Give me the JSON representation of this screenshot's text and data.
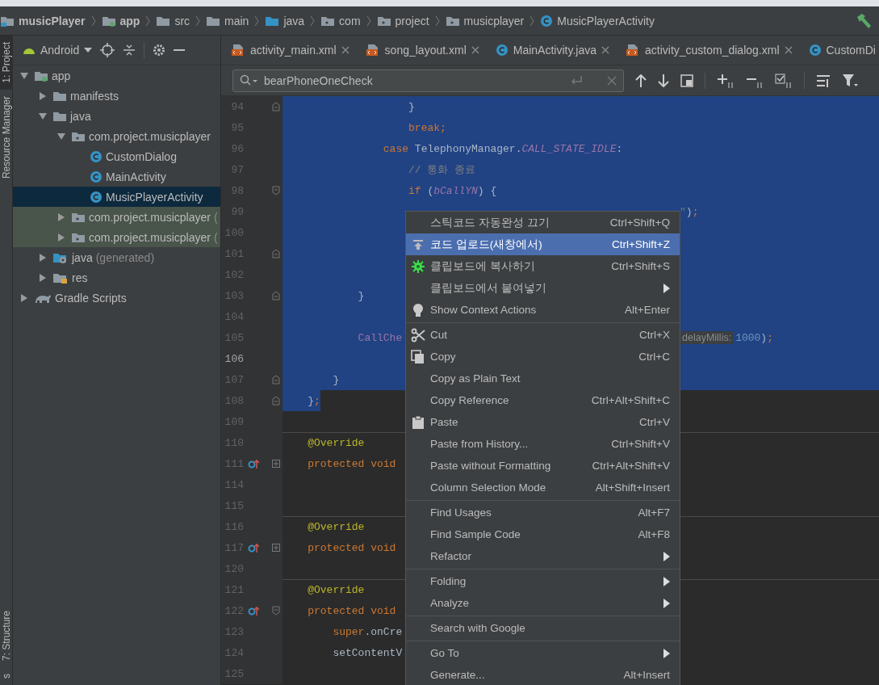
{
  "breadcrumbs": [
    {
      "label": "musicPlayer",
      "kind": "project",
      "bold": true
    },
    {
      "label": "app",
      "kind": "module",
      "bold": true
    },
    {
      "label": "src",
      "kind": "folder",
      "bold": false
    },
    {
      "label": "main",
      "kind": "folder",
      "bold": false
    },
    {
      "label": "java",
      "kind": "source",
      "bold": false
    },
    {
      "label": "com",
      "kind": "package",
      "bold": false
    },
    {
      "label": "project",
      "kind": "package",
      "bold": false
    },
    {
      "label": "musicplayer",
      "kind": "package",
      "bold": false
    },
    {
      "label": "MusicPlayerActivity",
      "kind": "class",
      "bold": false
    }
  ],
  "tool_strip": {
    "top": [
      {
        "label": "1: Project",
        "selected": true
      },
      {
        "label": "Resource Manager",
        "selected": false
      }
    ],
    "bottom": [
      {
        "label": "7: Structure",
        "selected": false
      },
      {
        "label": "s",
        "selected": false
      }
    ]
  },
  "project_view": {
    "mode": "Android"
  },
  "tree": [
    {
      "label": "app",
      "kind": "module",
      "expanded": true,
      "selected": false,
      "highlighted": false,
      "children": [
        {
          "label": "manifests",
          "kind": "folder",
          "expanded": false,
          "selected": false,
          "highlighted": false
        },
        {
          "label": "java",
          "kind": "folder",
          "expanded": true,
          "selected": false,
          "highlighted": false,
          "children": [
            {
              "label": "com.project.musicplayer",
              "kind": "package",
              "expanded": true,
              "selected": false,
              "highlighted": false,
              "children": [
                {
                  "label": "CustomDialog",
                  "kind": "class",
                  "selected": false,
                  "highlighted": false
                },
                {
                  "label": "MainActivity",
                  "kind": "class",
                  "selected": false,
                  "highlighted": false
                },
                {
                  "label": "MusicPlayerActivity",
                  "kind": "class",
                  "selected": true,
                  "highlighted": false
                }
              ]
            },
            {
              "label": "com.project.musicplayer",
              "suffix": "(",
              "kind": "package",
              "expanded": false,
              "selected": false,
              "highlighted": true
            },
            {
              "label": "com.project.musicplayer",
              "suffix": "(",
              "kind": "package",
              "expanded": false,
              "selected": false,
              "highlighted": true
            }
          ]
        },
        {
          "label": "java",
          "suffix": "(generated)",
          "kind": "generated",
          "expanded": false,
          "selected": false,
          "highlighted": false
        },
        {
          "label": "res",
          "kind": "res",
          "expanded": false,
          "selected": false,
          "highlighted": false
        }
      ]
    },
    {
      "label": "Gradle Scripts",
      "kind": "gradle",
      "expanded": false,
      "selected": false,
      "highlighted": false
    }
  ],
  "tabs": [
    {
      "label": "activity_main.xml",
      "kind": "xml",
      "selected": false,
      "closable": true
    },
    {
      "label": "song_layout.xml",
      "kind": "xml",
      "selected": false,
      "closable": true
    },
    {
      "label": "MainActivity.java",
      "kind": "class",
      "selected": false,
      "closable": true
    },
    {
      "label": "activity_custom_dialog.xml",
      "kind": "xml",
      "selected": false,
      "closable": true
    },
    {
      "label": "CustomDi",
      "kind": "class",
      "selected": false,
      "closable": false
    }
  ],
  "find": {
    "value": "bearPhoneOneCheck"
  },
  "code_lines": [
    {
      "number": "94",
      "selected": true,
      "current": false,
      "divider": false,
      "fold_end": true,
      "left": [
        {
          "text": "                    }",
          "kind": "plain"
        }
      ]
    },
    {
      "number": "95",
      "selected": true,
      "current": false,
      "divider": false,
      "left": [
        {
          "text": "                    break;",
          "kind": "keyword"
        }
      ]
    },
    {
      "number": "96",
      "selected": true,
      "current": false,
      "divider": false,
      "left": [
        {
          "text": "                case",
          "kind": "keyword"
        },
        {
          "text": " TelephonyManager.",
          "kind": "plain"
        },
        {
          "text": "CALL_STATE_IDLE",
          "kind": "constant"
        },
        {
          "text": ":",
          "kind": "plain"
        }
      ]
    },
    {
      "number": "97",
      "selected": true,
      "current": false,
      "divider": false,
      "left": [
        {
          "text": "                    // 통화 종료",
          "kind": "comment"
        }
      ]
    },
    {
      "number": "98",
      "selected": true,
      "current": false,
      "divider": false,
      "fold_start": true,
      "left": [
        {
          "text": "                    if",
          "kind": "keyword"
        },
        {
          "text": " (",
          "kind": "plain"
        },
        {
          "text": "bCallYN",
          "kind": "constant"
        },
        {
          "text": ") {",
          "kind": "plain"
        }
      ]
    },
    {
      "number": "99",
      "selected": true,
      "current": false,
      "divider": false,
      "right": [
        {
          "text": "\"",
          "kind": "string"
        },
        {
          "text": ")",
          "kind": "plain"
        },
        {
          "text": ";",
          "kind": "keyword"
        }
      ]
    },
    {
      "number": "100",
      "selected": true,
      "current": false,
      "divider": false
    },
    {
      "number": "101",
      "selected": true,
      "current": false,
      "divider": false,
      "fold_end": true
    },
    {
      "number": "102",
      "selected": true,
      "current": false,
      "divider": false
    },
    {
      "number": "103",
      "selected": true,
      "current": false,
      "divider": false,
      "fold_end": true,
      "left": [
        {
          "text": "            }",
          "kind": "plain"
        }
      ]
    },
    {
      "number": "104",
      "selected": true,
      "current": false,
      "divider": false
    },
    {
      "number": "105",
      "selected": true,
      "current": false,
      "divider": false,
      "left": [
        {
          "text": "            CallChe",
          "kind": "member"
        }
      ],
      "right": [
        {
          "text": "delayMillis:",
          "kind": "hint"
        },
        {
          "text": "1000",
          "kind": "number"
        },
        {
          "text": ")",
          "kind": "plain"
        },
        {
          "text": ";",
          "kind": "keyword"
        }
      ]
    },
    {
      "number": "106",
      "selected": true,
      "current": true,
      "divider": false
    },
    {
      "number": "107",
      "selected": true,
      "current": false,
      "divider": false,
      "fold_end": true,
      "left": [
        {
          "text": "        }",
          "kind": "plain"
        }
      ]
    },
    {
      "number": "108",
      "selected": false,
      "text_selected": true,
      "current": false,
      "divider": false,
      "fold_end": true,
      "left": [
        {
          "text": "    }",
          "kind": "plain"
        },
        {
          "text": ";",
          "kind": "keyword"
        }
      ]
    },
    {
      "number": "109",
      "selected": false,
      "current": false,
      "divider": false
    },
    {
      "number": "110",
      "selected": false,
      "current": false,
      "divider": true,
      "left": [
        {
          "text": "    @Override",
          "kind": "annotation"
        }
      ]
    },
    {
      "number": "111",
      "selected": false,
      "current": false,
      "divider": false,
      "overrides": true,
      "folded": true,
      "left": [
        {
          "text": "    protected void",
          "kind": "keyword"
        }
      ]
    },
    {
      "number": "114",
      "selected": false,
      "current": false,
      "divider": false
    },
    {
      "number": "115",
      "selected": false,
      "current": false,
      "divider": false
    },
    {
      "number": "116",
      "selected": false,
      "current": false,
      "divider": true,
      "left": [
        {
          "text": "    @Override",
          "kind": "annotation"
        }
      ]
    },
    {
      "number": "117",
      "selected": false,
      "current": false,
      "divider": false,
      "overrides": true,
      "folded": true,
      "left": [
        {
          "text": "    protected void",
          "kind": "keyword"
        }
      ]
    },
    {
      "number": "120",
      "selected": false,
      "current": false,
      "divider": false
    },
    {
      "number": "121",
      "selected": false,
      "current": false,
      "divider": true,
      "left": [
        {
          "text": "    @Override",
          "kind": "annotation"
        }
      ]
    },
    {
      "number": "122",
      "selected": false,
      "current": false,
      "divider": false,
      "overrides": true,
      "fold_start": true,
      "left": [
        {
          "text": "    protected void",
          "kind": "keyword"
        }
      ]
    },
    {
      "number": "123",
      "selected": false,
      "current": false,
      "divider": false,
      "left": [
        {
          "text": "        super",
          "kind": "keyword"
        },
        {
          "text": ".onCre",
          "kind": "plain"
        }
      ]
    },
    {
      "number": "124",
      "selected": false,
      "current": false,
      "divider": false,
      "left": [
        {
          "text": "        setContentV",
          "kind": "plain"
        }
      ]
    },
    {
      "number": "125",
      "selected": false,
      "current": false,
      "divider": false
    }
  ],
  "context_menu": [
    {
      "kind": "plain",
      "label": "스틱코드 자동완성 끄기",
      "shortcut": "Ctrl+Shift+Q",
      "submenu": false,
      "selected": false
    },
    {
      "kind": "upload",
      "label": "코드 업로드(새창에서)",
      "shortcut": "Ctrl+Shift+Z",
      "submenu": false,
      "selected": true
    },
    {
      "kind": "bug",
      "label": "클립보드에 복사하기",
      "shortcut": "Ctrl+Shift+S",
      "submenu": false,
      "selected": false
    },
    {
      "kind": "plain",
      "label": "클립보드에서 붙여넣기",
      "submenu": true,
      "selected": false
    },
    {
      "kind": "bulb",
      "label": "Show Context Actions",
      "shortcut": "Alt+Enter",
      "submenu": false,
      "selected": false
    },
    {
      "kind": "separator"
    },
    {
      "kind": "cut",
      "label": "Cut",
      "shortcut": "Ctrl+X",
      "submenu": false,
      "selected": false
    },
    {
      "kind": "copy",
      "label": "Copy",
      "shortcut": "Ctrl+C",
      "submenu": false,
      "selected": false
    },
    {
      "kind": "plain",
      "label": "Copy as Plain Text",
      "submenu": false,
      "selected": false
    },
    {
      "kind": "plain",
      "label": "Copy Reference",
      "shortcut": "Ctrl+Alt+Shift+C",
      "submenu": false,
      "selected": false
    },
    {
      "kind": "paste",
      "label": "Paste",
      "shortcut": "Ctrl+V",
      "submenu": false,
      "selected": false
    },
    {
      "kind": "plain",
      "label": "Paste from History...",
      "shortcut": "Ctrl+Shift+V",
      "submenu": false,
      "selected": false
    },
    {
      "kind": "plain",
      "label": "Paste without Formatting",
      "shortcut": "Ctrl+Alt+Shift+V",
      "submenu": false,
      "selected": false
    },
    {
      "kind": "plain",
      "label": "Column Selection Mode",
      "shortcut": "Alt+Shift+Insert",
      "submenu": false,
      "selected": false
    },
    {
      "kind": "separator"
    },
    {
      "kind": "plain",
      "label": "Find Usages",
      "shortcut": "Alt+F7",
      "submenu": false,
      "selected": false
    },
    {
      "kind": "plain",
      "label": "Find Sample Code",
      "shortcut": "Alt+F8",
      "submenu": false,
      "selected": false
    },
    {
      "kind": "plain",
      "label": "Refactor",
      "submenu": true,
      "selected": false
    },
    {
      "kind": "separator"
    },
    {
      "kind": "plain",
      "label": "Folding",
      "submenu": true,
      "selected": false
    },
    {
      "kind": "plain",
      "label": "Analyze",
      "submenu": true,
      "selected": false
    },
    {
      "kind": "separator"
    },
    {
      "kind": "plain",
      "label": "Search with Google",
      "submenu": false,
      "selected": false
    },
    {
      "kind": "separator"
    },
    {
      "kind": "plain",
      "label": "Go To",
      "submenu": true,
      "selected": false
    },
    {
      "kind": "plain",
      "label": "Generate...",
      "shortcut": "Alt+Insert",
      "submenu": false,
      "selected": false
    }
  ]
}
